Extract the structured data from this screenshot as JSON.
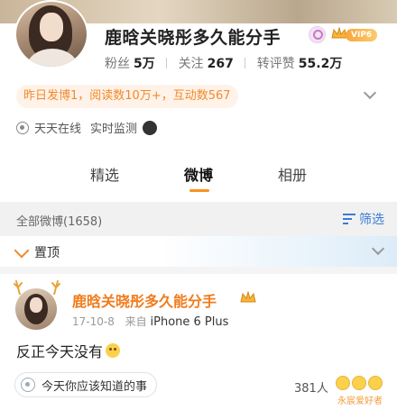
{
  "profile": {
    "name": "鹿晗关晓彤多久能分手",
    "vip_badge": "VIP6",
    "stats": [
      {
        "label": "粉丝",
        "value": "5万"
      },
      {
        "label": "关注",
        "value": "267"
      },
      {
        "label": "转评赞",
        "value": "55.2万"
      }
    ],
    "activity": "昨日发博1，阅读数10万+，互动数567",
    "online_status": "天天在线",
    "monitor_label": "实时监测"
  },
  "tabs": [
    {
      "label": "精选"
    },
    {
      "label": "微博"
    },
    {
      "label": "相册"
    }
  ],
  "section": {
    "count_label": "全部微博(1658)",
    "filter_label": "筛选"
  },
  "pinned_label": "置顶",
  "post": {
    "author": "鹿晗关晓彤多久能分手",
    "date": "17-10-8",
    "source_prefix": "来自",
    "device": "iPhone 6 Plus",
    "text": "反正今天没有",
    "topic": "今天你应该知道的事",
    "likes": "381人"
  },
  "watermark": "永宸爱好者",
  "icons": {
    "crown": "crown-icon",
    "search": "search-icon",
    "filter": "filter-icon",
    "pin": "pin-icon",
    "topic": "topic-icon"
  },
  "colors": {
    "accent_orange": "#f07c1c",
    "link_blue": "#3a7bd5",
    "tab_underline": "#f7931e"
  }
}
